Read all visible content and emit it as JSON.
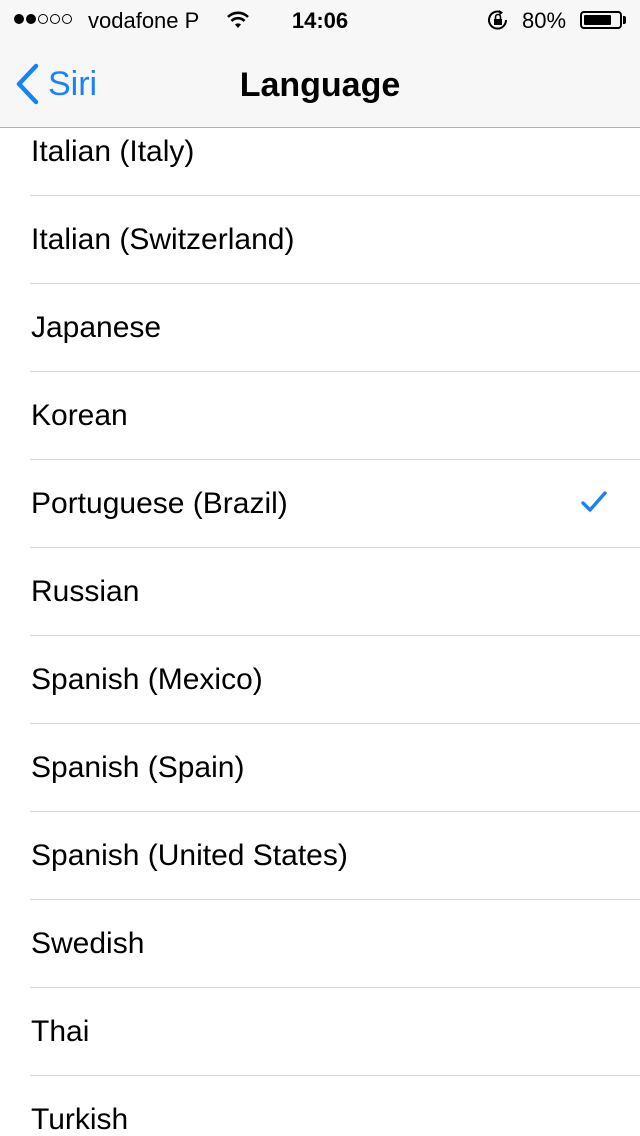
{
  "status_bar": {
    "signal_dots_filled": 2,
    "signal_dots_total": 5,
    "carrier": "vodafone P",
    "time": "14:06",
    "battery_percent": "80%",
    "battery_level": 0.8,
    "icons": [
      "wifi-icon",
      "rotation-lock-icon",
      "battery-icon"
    ]
  },
  "nav": {
    "back_label": "Siri",
    "title": "Language"
  },
  "accent_color": "#1a82f7",
  "languages": [
    {
      "label": "Italian (Italy)",
      "selected": false
    },
    {
      "label": "Italian (Switzerland)",
      "selected": false
    },
    {
      "label": "Japanese",
      "selected": false
    },
    {
      "label": "Korean",
      "selected": false
    },
    {
      "label": "Portuguese (Brazil)",
      "selected": true
    },
    {
      "label": "Russian",
      "selected": false
    },
    {
      "label": "Spanish (Mexico)",
      "selected": false
    },
    {
      "label": "Spanish (Spain)",
      "selected": false
    },
    {
      "label": "Spanish (United States)",
      "selected": false
    },
    {
      "label": "Swedish",
      "selected": false
    },
    {
      "label": "Thai",
      "selected": false
    },
    {
      "label": "Turkish",
      "selected": false
    }
  ]
}
